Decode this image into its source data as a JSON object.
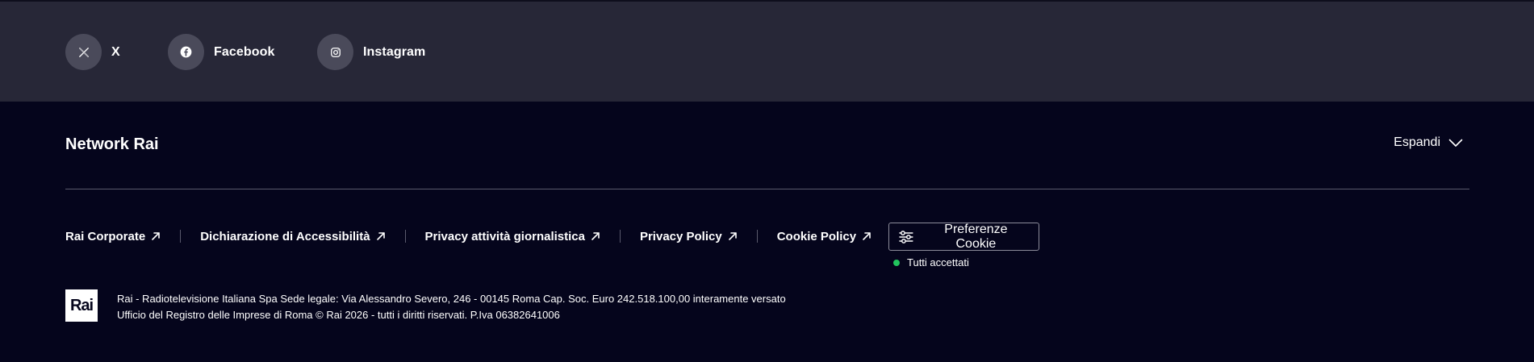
{
  "social": {
    "items": [
      {
        "label": "X",
        "icon": "x-icon"
      },
      {
        "label": "Facebook",
        "icon": "facebook-icon"
      },
      {
        "label": "Instagram",
        "icon": "instagram-icon"
      }
    ]
  },
  "network": {
    "title": "Network Rai",
    "expand_label": "Espandi"
  },
  "legal": {
    "links": [
      {
        "label": "Rai Corporate",
        "icon": "external-arrow-icon"
      },
      {
        "label": "Dichiarazione di Accessibilità",
        "icon": "external-arrow-icon"
      },
      {
        "label": "Privacy attività giornalistica",
        "icon": "external-arrow-icon"
      },
      {
        "label": "Privacy Policy",
        "icon": "external-arrow-icon"
      },
      {
        "label": "Cookie Policy",
        "icon": "external-arrow-icon"
      }
    ],
    "cookie_button_label": "Preferenze Cookie",
    "cookie_status": "Tutti accettati"
  },
  "footer": {
    "logo_text": "Rai",
    "line1": "Rai - Radiotelevisione Italiana Spa Sede legale: Via Alessandro Severo, 246 - 00145 Roma Cap. Soc. Euro 242.518.100,00 interamente versato",
    "line2": "Ufficio del Registro delle Imprese di Roma © Rai 2026 - tutti i diritti riservati. P.Iva 06382641006"
  },
  "colors": {
    "background": "#05051c",
    "social_bar": "#272737",
    "status_accepted": "#22c55e"
  }
}
